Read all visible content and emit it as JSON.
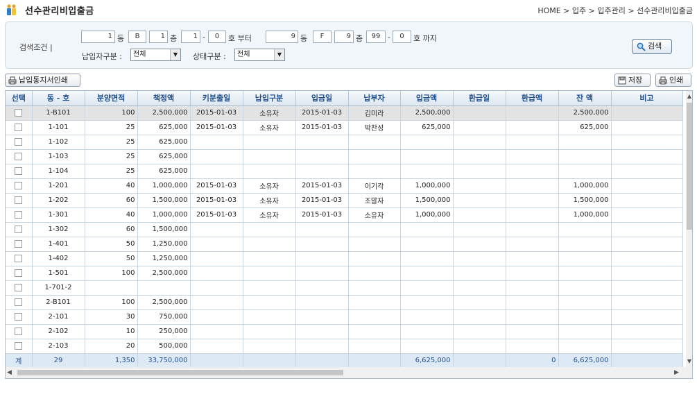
{
  "header": {
    "title": "선수관리비입출금",
    "breadcrumb": "HOME > 입주 > 입주관리 > 선수관리비입출금"
  },
  "search": {
    "label": "검색조건 |",
    "from": {
      "dong": "1",
      "dong_code": "B",
      "floor": "1",
      "ho1": "1",
      "ho2": "0"
    },
    "to": {
      "dong": "9",
      "dong_code": "F",
      "floor": "9",
      "ho1": "99",
      "ho2": "0"
    },
    "labels": {
      "dong": "동",
      "floor": "층",
      "dash": "-",
      "ho_from": "호 부터",
      "ho_to": "호 까지"
    },
    "payer_label": "납입자구분 :",
    "payer_value": "전체",
    "status_label": "상태구분 :",
    "status_value": "전체",
    "search_button": "검색"
  },
  "toolbar": {
    "print_notice": "납입통지서인쇄",
    "save": "저장",
    "print": "인쇄"
  },
  "grid": {
    "columns": [
      "선택",
      "동 - 호",
      "분양면적",
      "책정액",
      "키분출일",
      "납입구분",
      "입금일",
      "납부자",
      "입금액",
      "환급일",
      "환급액",
      "잔 액",
      "비고"
    ],
    "rows": [
      {
        "unit": "1-B101",
        "area": "100",
        "amount": "2,500,000",
        "key_date": "2015-01-03",
        "type": "소유자",
        "deposit_date": "2015-01-03",
        "payer": "김미라",
        "deposit": "2,500,000",
        "refund_date": "",
        "refund": "",
        "balance": "2,500,000",
        "note": ""
      },
      {
        "unit": "1-101",
        "area": "25",
        "amount": "625,000",
        "key_date": "2015-01-03",
        "type": "소유자",
        "deposit_date": "2015-01-03",
        "payer": "박찬성",
        "deposit": "625,000",
        "refund_date": "",
        "refund": "",
        "balance": "625,000",
        "note": ""
      },
      {
        "unit": "1-102",
        "area": "25",
        "amount": "625,000",
        "key_date": "",
        "type": "",
        "deposit_date": "",
        "payer": "",
        "deposit": "",
        "refund_date": "",
        "refund": "",
        "balance": "",
        "note": ""
      },
      {
        "unit": "1-103",
        "area": "25",
        "amount": "625,000",
        "key_date": "",
        "type": "",
        "deposit_date": "",
        "payer": "",
        "deposit": "",
        "refund_date": "",
        "refund": "",
        "balance": "",
        "note": ""
      },
      {
        "unit": "1-104",
        "area": "25",
        "amount": "625,000",
        "key_date": "",
        "type": "",
        "deposit_date": "",
        "payer": "",
        "deposit": "",
        "refund_date": "",
        "refund": "",
        "balance": "",
        "note": ""
      },
      {
        "unit": "1-201",
        "area": "40",
        "amount": "1,000,000",
        "key_date": "2015-01-03",
        "type": "소유자",
        "deposit_date": "2015-01-03",
        "payer": "이기각",
        "deposit": "1,000,000",
        "refund_date": "",
        "refund": "",
        "balance": "1,000,000",
        "note": ""
      },
      {
        "unit": "1-202",
        "area": "60",
        "amount": "1,500,000",
        "key_date": "2015-01-03",
        "type": "소유자",
        "deposit_date": "2015-01-03",
        "payer": "조말자",
        "deposit": "1,500,000",
        "refund_date": "",
        "refund": "",
        "balance": "1,500,000",
        "note": ""
      },
      {
        "unit": "1-301",
        "area": "40",
        "amount": "1,000,000",
        "key_date": "2015-01-03",
        "type": "소유자",
        "deposit_date": "2015-01-03",
        "payer": "소유자",
        "deposit": "1,000,000",
        "refund_date": "",
        "refund": "",
        "balance": "1,000,000",
        "note": ""
      },
      {
        "unit": "1-302",
        "area": "60",
        "amount": "1,500,000",
        "key_date": "",
        "type": "",
        "deposit_date": "",
        "payer": "",
        "deposit": "",
        "refund_date": "",
        "refund": "",
        "balance": "",
        "note": ""
      },
      {
        "unit": "1-401",
        "area": "50",
        "amount": "1,250,000",
        "key_date": "",
        "type": "",
        "deposit_date": "",
        "payer": "",
        "deposit": "",
        "refund_date": "",
        "refund": "",
        "balance": "",
        "note": ""
      },
      {
        "unit": "1-402",
        "area": "50",
        "amount": "1,250,000",
        "key_date": "",
        "type": "",
        "deposit_date": "",
        "payer": "",
        "deposit": "",
        "refund_date": "",
        "refund": "",
        "balance": "",
        "note": ""
      },
      {
        "unit": "1-501",
        "area": "100",
        "amount": "2,500,000",
        "key_date": "",
        "type": "",
        "deposit_date": "",
        "payer": "",
        "deposit": "",
        "refund_date": "",
        "refund": "",
        "balance": "",
        "note": ""
      },
      {
        "unit": "1-701-2",
        "area": "",
        "amount": "",
        "key_date": "",
        "type": "",
        "deposit_date": "",
        "payer": "",
        "deposit": "",
        "refund_date": "",
        "refund": "",
        "balance": "",
        "note": ""
      },
      {
        "unit": "2-B101",
        "area": "100",
        "amount": "2,500,000",
        "key_date": "",
        "type": "",
        "deposit_date": "",
        "payer": "",
        "deposit": "",
        "refund_date": "",
        "refund": "",
        "balance": "",
        "note": ""
      },
      {
        "unit": "2-101",
        "area": "30",
        "amount": "750,000",
        "key_date": "",
        "type": "",
        "deposit_date": "",
        "payer": "",
        "deposit": "",
        "refund_date": "",
        "refund": "",
        "balance": "",
        "note": ""
      },
      {
        "unit": "2-102",
        "area": "10",
        "amount": "250,000",
        "key_date": "",
        "type": "",
        "deposit_date": "",
        "payer": "",
        "deposit": "",
        "refund_date": "",
        "refund": "",
        "balance": "",
        "note": ""
      },
      {
        "unit": "2-103",
        "area": "20",
        "amount": "500,000",
        "key_date": "",
        "type": "",
        "deposit_date": "",
        "payer": "",
        "deposit": "",
        "refund_date": "",
        "refund": "",
        "balance": "",
        "note": ""
      }
    ],
    "selected_row": 0,
    "summary": {
      "label": "계",
      "unit_count": "29",
      "area": "1,350",
      "amount": "33,750,000",
      "deposit": "6,625,000",
      "refund": "0",
      "balance": "6,625,000"
    }
  },
  "colors": {
    "header_text": "#1f4f8f",
    "selected_row": "#e3e3e3",
    "summary_row": "#dde9f5"
  }
}
